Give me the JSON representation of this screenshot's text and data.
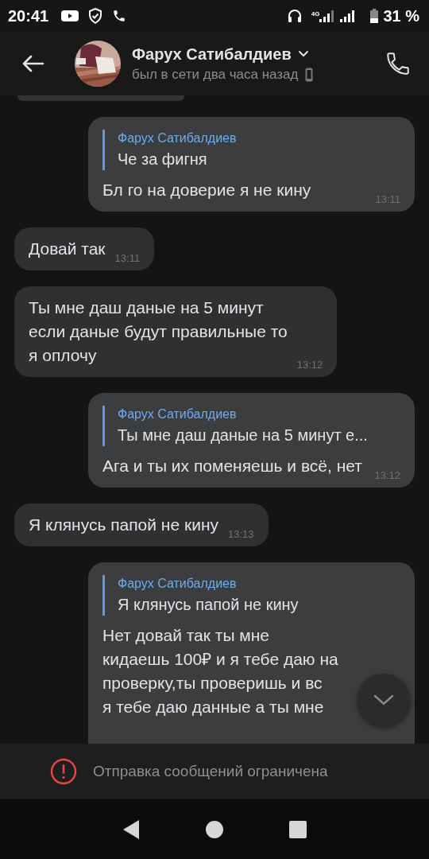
{
  "status_bar": {
    "time": "20:41",
    "network_type": "4G",
    "battery": "31 %"
  },
  "header": {
    "name": "Фарух Сатибалдиев",
    "status": "был в сети два часа назад"
  },
  "messages": [
    {
      "kind": "outgoing",
      "reply": {
        "name": "Фарух Сатибалдиев",
        "text": "Че за фигня"
      },
      "lines": [
        "Бл го на доверие я не кину"
      ],
      "time": "13:11"
    },
    {
      "kind": "incoming",
      "lines": [
        "Довай так"
      ],
      "time": "13:11"
    },
    {
      "kind": "incoming",
      "lines": [
        "Ты мне даш даные на 5 минут",
        "если даные будут правильные то",
        "я оплочу"
      ],
      "time": "13:12"
    },
    {
      "kind": "outgoing",
      "reply": {
        "name": "Фарух Сатибалдиев",
        "text": "Ты мне даш даные на 5 минут е..."
      },
      "lines": [
        "Ага и ты их поменяешь и всё, нет"
      ],
      "time": "13:12"
    },
    {
      "kind": "incoming",
      "lines": [
        "Я клянусь папой не кину"
      ],
      "time": "13:13"
    },
    {
      "kind": "outgoing",
      "reply": {
        "name": "Фарух Сатибалдиев",
        "text": "Я клянусь папой не кину"
      },
      "lines": [
        "Нет довай так ты мне",
        "кидаешь 100₽ и я тебе даю на",
        "проверку,ты проверишь и вс",
        "я тебе даю данные а ты мне"
      ]
    }
  ],
  "notice": "Отправка сообщений ограничена"
}
